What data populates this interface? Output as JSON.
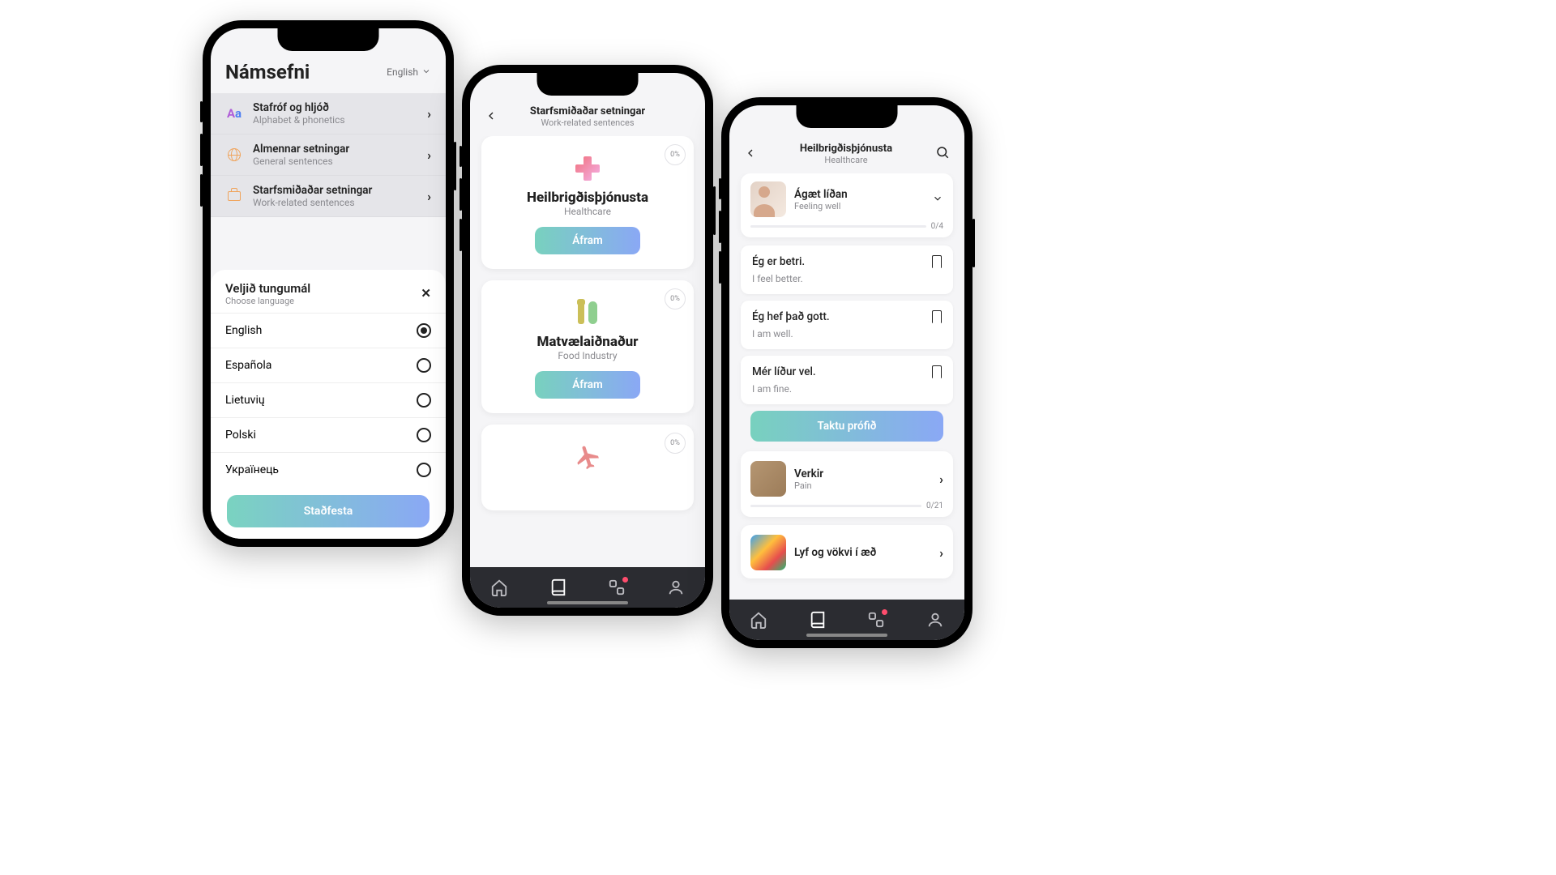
{
  "phone1": {
    "title": "Námsefni",
    "top_lang_label": "English",
    "categories": [
      {
        "title": "Stafróf og hljóð",
        "sub": "Alphabet & phonetics",
        "icon": "aa"
      },
      {
        "title": "Almennar setningar",
        "sub": "General sentences",
        "icon": "globe"
      },
      {
        "title": "Starfsmiðaðar setningar",
        "sub": "Work-related sentences",
        "icon": "briefcase"
      }
    ],
    "sheet": {
      "title": "Veljið tungumál",
      "sub": "Choose language",
      "options": [
        {
          "label": "English",
          "selected": true
        },
        {
          "label": "Española",
          "selected": false
        },
        {
          "label": "Lietuvių",
          "selected": false
        },
        {
          "label": "Polski",
          "selected": false
        },
        {
          "label": "Українець",
          "selected": false
        }
      ],
      "confirm": "Staðfesta"
    }
  },
  "phone2": {
    "header_title": "Starfsmiðaðar setningar",
    "header_sub": "Work-related sentences",
    "cards": [
      {
        "title": "Heilbrigðisþjónusta",
        "sub": "Healthcare",
        "pct": "0%",
        "cta": "Áfram",
        "icon": "plus"
      },
      {
        "title": "Matvælaiðnaður",
        "sub": "Food Industry",
        "pct": "0%",
        "cta": "Áfram",
        "icon": "cutlery"
      },
      {
        "title": "",
        "sub": "",
        "pct": "0%",
        "cta": "",
        "icon": "plane"
      }
    ]
  },
  "phone3": {
    "header_title": "Heilbrigðisþjónusta",
    "header_sub": "Healthcare",
    "section1": {
      "title": "Ágæt líðan",
      "sub": "Feeling well",
      "count": "0/4"
    },
    "sentences": [
      {
        "main": "Ég er betri.",
        "sub": "I feel better."
      },
      {
        "main": "Ég hef það gott.",
        "sub": "I am well."
      },
      {
        "main": "Mér líður vel.",
        "sub": "I am fine."
      }
    ],
    "take_test": "Taktu prófið",
    "section2": {
      "title": "Verkir",
      "sub": "Pain",
      "count": "0/21"
    },
    "section3": {
      "title": "Lyf og vökvi í æð"
    }
  }
}
